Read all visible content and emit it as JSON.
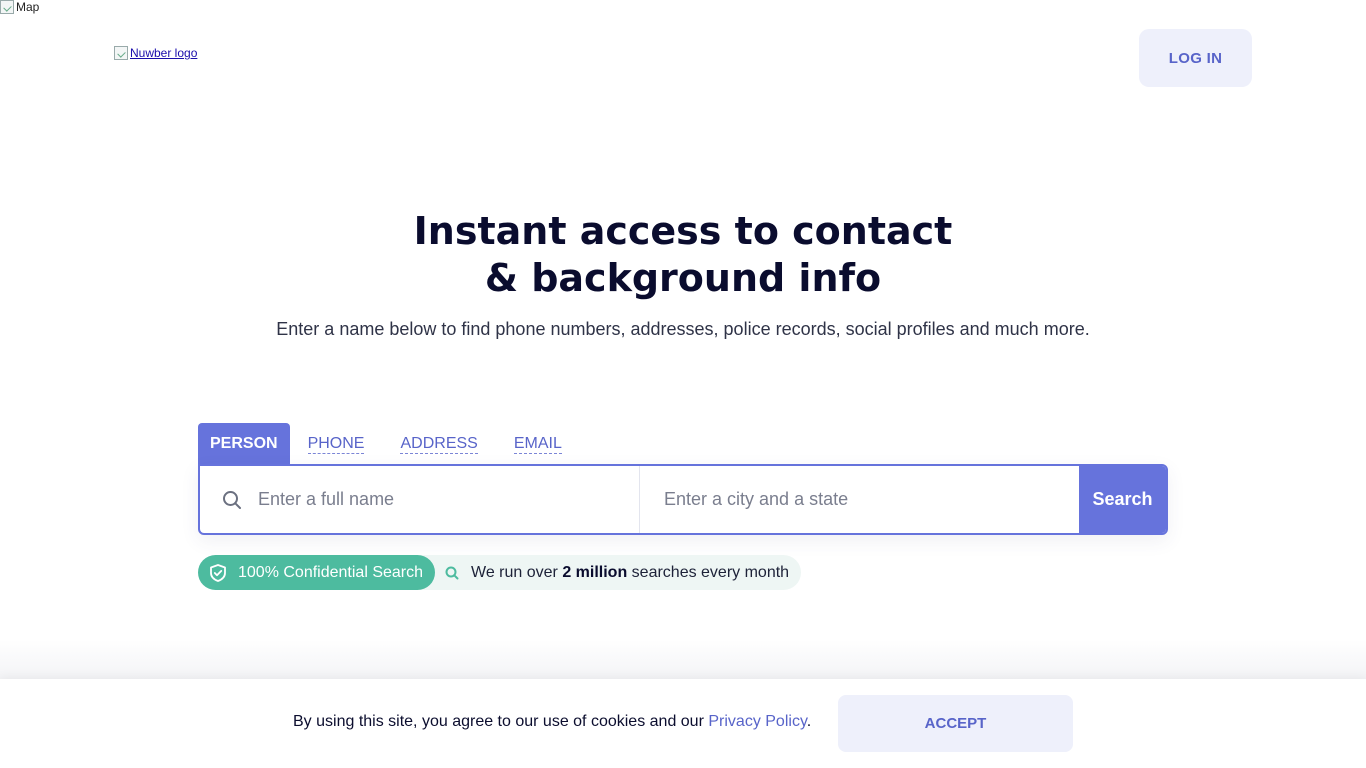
{
  "map_alt": "Map",
  "logo_alt": "Nuwber logo",
  "header": {
    "login_label": "LOG IN"
  },
  "hero": {
    "title_line1": "Instant access to contact",
    "title_line2": "& background info",
    "subtitle": "Enter a name below to find phone numbers, addresses, police records, social profiles and much more."
  },
  "search": {
    "tabs": [
      {
        "label": "PERSON",
        "active": true
      },
      {
        "label": "PHONE",
        "active": false
      },
      {
        "label": "ADDRESS",
        "active": false
      },
      {
        "label": "EMAIL",
        "active": false
      }
    ],
    "name_placeholder": "Enter a full name",
    "city_placeholder": "Enter a city and a state",
    "button_label": "Search"
  },
  "badges": {
    "confidential": "100% Confidential Search",
    "stats_prefix": "We run over ",
    "stats_bold": "2 million",
    "stats_suffix": " searches every month"
  },
  "cookie": {
    "text": "By using this site, you agree to our use of cookies and our ",
    "link": "Privacy Policy",
    "period": ".",
    "accept_label": "ACCEPT"
  },
  "colors": {
    "accent": "#6673dc",
    "accent_text": "#5864c9",
    "badge_green": "#4dbb9f",
    "button_light": "#eef0fb"
  },
  "icons": [
    "broken-image-icon",
    "search-icon",
    "shield-check-icon"
  ]
}
